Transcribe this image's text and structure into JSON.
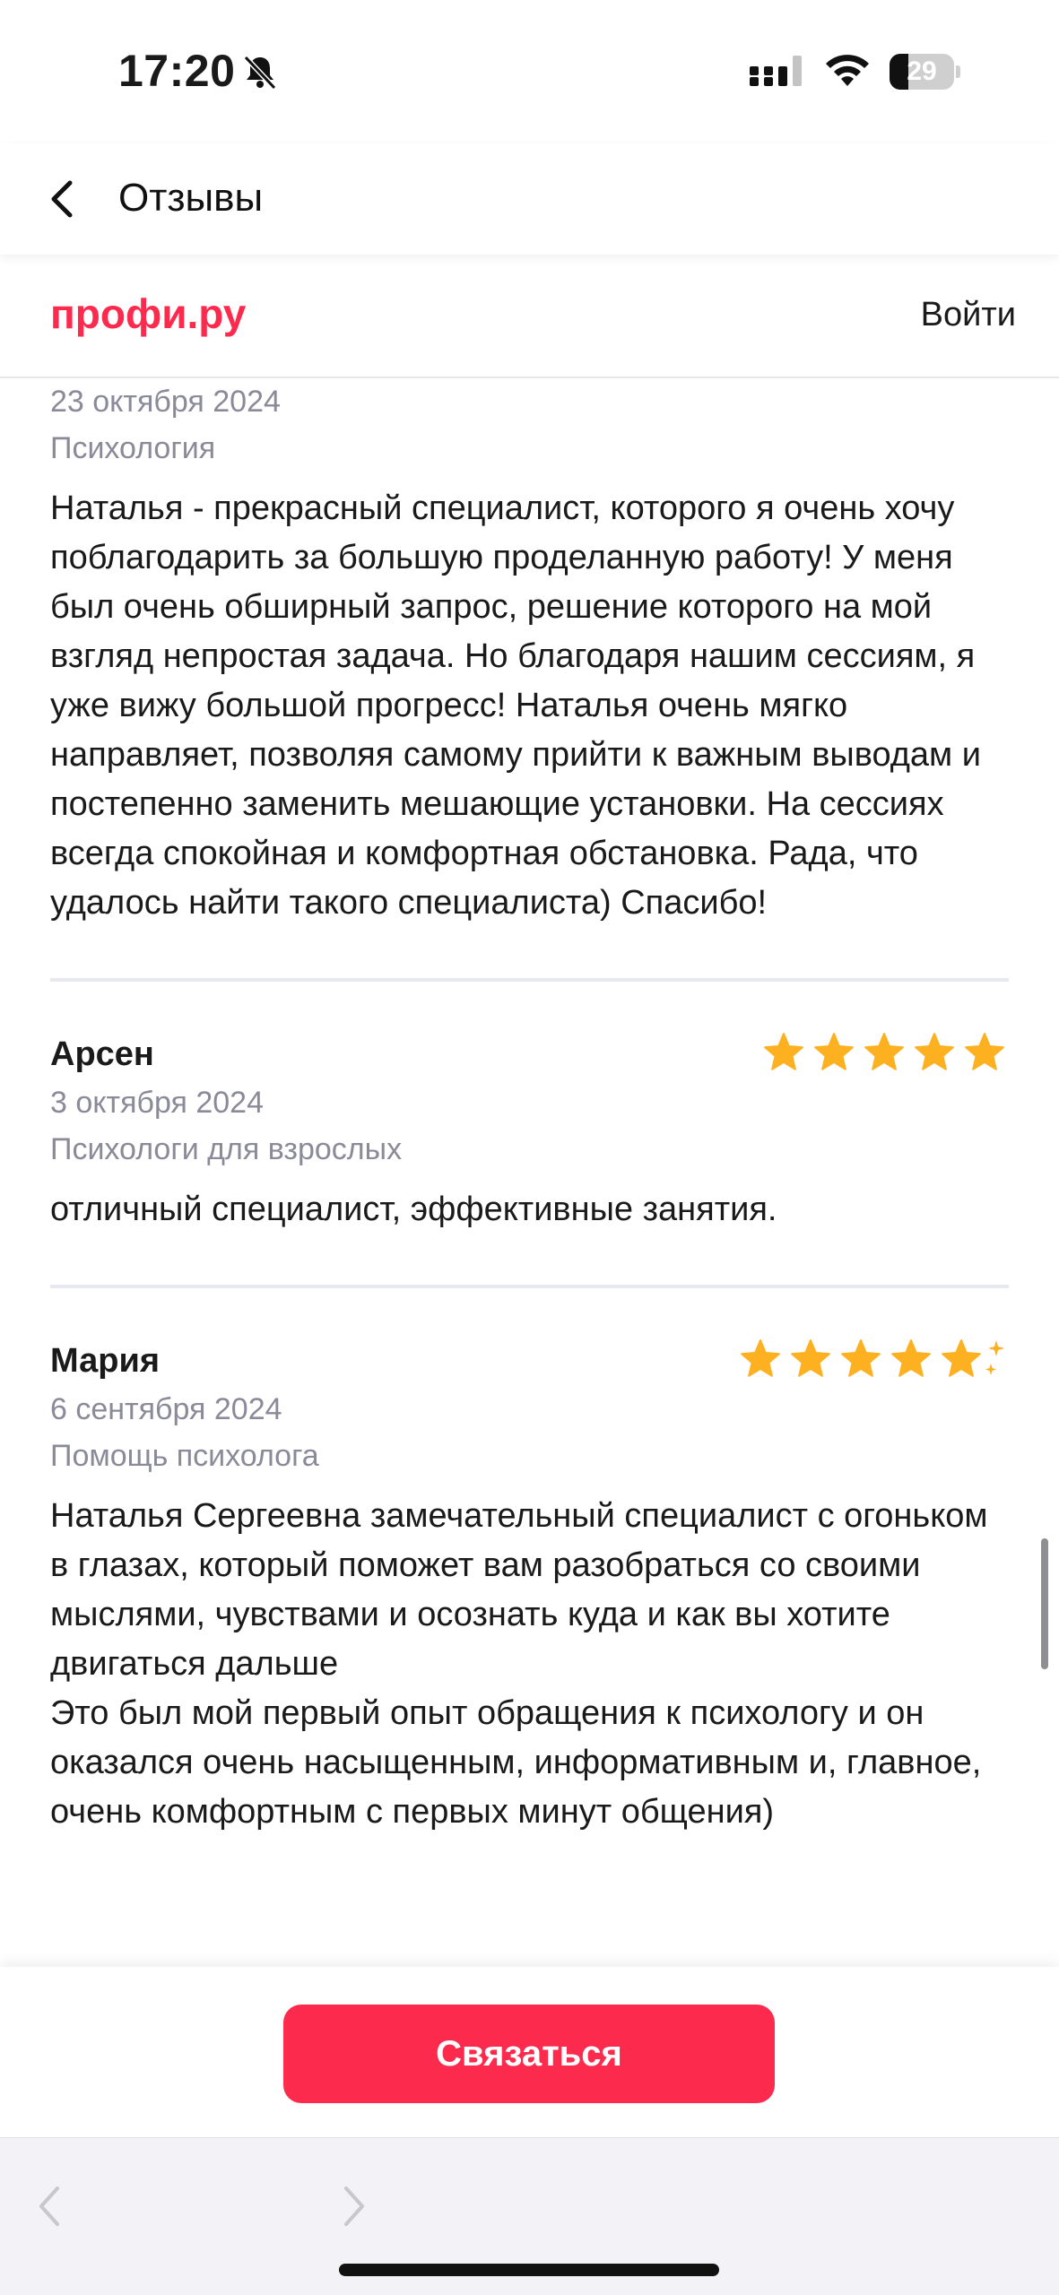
{
  "status_bar": {
    "time": "17:20",
    "battery": "29",
    "battery_level": 0.29,
    "icons": [
      "bell-off-icon",
      "cellular-signal-icon",
      "wifi-icon",
      "battery-icon"
    ]
  },
  "nav": {
    "title": "Отзывы",
    "back_icon": "chevron-left-icon"
  },
  "site_header": {
    "logo_text": "профи.ру",
    "login_label": "Войти"
  },
  "reviews": [
    {
      "name": "",
      "date": "23 октября 2024",
      "category": "Психология",
      "text": "Наталья - прекрасный специалист, которого я очень хочу поблагодарить за большую проделанную работу! У меня был очень обширный запрос, решение которого на мой взгляд непростая задача. Но благодаря нашим сессиям, я уже вижу большой прогресс! Наталья очень мягко направляет, позволяя самому прийти к важным выводам и постепенно заменить мешающие установки. На сессиях всегда спокойная и комфортная обстановка. Рада, что удалось найти такого специалиста) Спасибо!"
    },
    {
      "name": "Арсен",
      "rating": 5,
      "date": "3 октября 2024",
      "category": "Психологи для взрослых",
      "text": "отличный специалист, эффективные занятия."
    },
    {
      "name": "Мария",
      "rating": 5,
      "rating_badge": "sparkle",
      "date": "6 сентября 2024",
      "category": "Помощь психолога",
      "text": "Наталья Сергеевна замечательный специалист с огоньком в глазах, который поможет вам разобраться со своими мыслями, чувствами и осознать куда и как вы хотите двигаться дальше\nЭто был мой первый опыт обращения к психологу и он оказался очень насыщенным, информативным и, главное, очень комфортным с первых минут общения)"
    }
  ],
  "colors": {
    "brand": "#fc2a4d",
    "star": "#fdb020",
    "muted": "#8a8a99"
  },
  "contact_button": {
    "label": "Связаться"
  },
  "browser_toolbar": {
    "icons": [
      "back-arrow-icon",
      "forward-arrow-icon"
    ]
  }
}
